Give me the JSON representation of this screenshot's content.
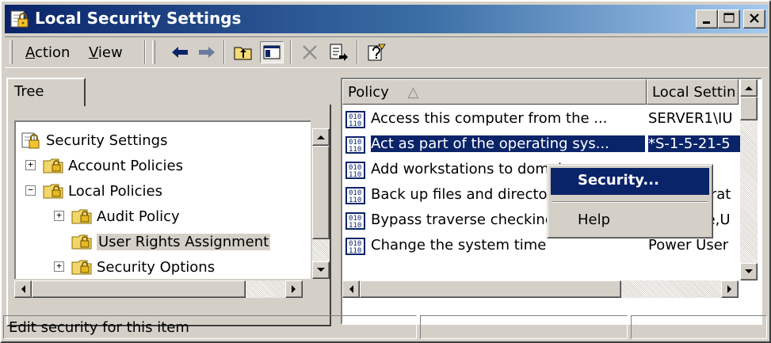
{
  "window": {
    "title": "Local Security Settings",
    "minimize_icon": "minimize-icon",
    "maximize_icon": "maximize-icon",
    "close_icon": "close-icon"
  },
  "toolbar": {
    "action_label": "Action",
    "action_mnemonic": "A",
    "view_label": "View",
    "view_mnemonic": "V",
    "icons": [
      "back-arrow-icon",
      "forward-arrow-icon",
      "up-folder-icon",
      "show-hide-tree-icon",
      "delete-icon",
      "export-list-icon",
      "help-icon"
    ]
  },
  "tree_pane": {
    "tab_label": "Tree",
    "items": [
      {
        "label": "Security Settings",
        "icon": "security-settings-icon",
        "level": 0,
        "expander": ""
      },
      {
        "label": "Account Policies",
        "icon": "folder-lock-icon",
        "level": 1,
        "expander": "+"
      },
      {
        "label": "Local Policies",
        "icon": "folder-lock-icon",
        "level": 1,
        "expander": "-"
      },
      {
        "label": "Audit Policy",
        "icon": "folder-lock-icon",
        "level": 2,
        "expander": "+"
      },
      {
        "label": "User Rights Assignment",
        "icon": "folder-lock-icon",
        "level": 2,
        "expander": "",
        "selected": true
      },
      {
        "label": "Security Options",
        "icon": "folder-lock-icon",
        "level": 2,
        "expander": "+"
      }
    ]
  },
  "list_pane": {
    "columns": [
      {
        "label": "Policy",
        "sort_indicator": "△"
      },
      {
        "label": "Local Settin"
      }
    ],
    "rows": [
      {
        "policy": "Access this computer from the ...",
        "setting": "SERVER1\\IU"
      },
      {
        "policy": "Act as part of the operating sys...",
        "setting": "*S-1-5-21-5",
        "selected": true
      },
      {
        "policy": "Add workstations to domain",
        "setting": ""
      },
      {
        "policy": "Back up files and directories",
        "setting": "Administrat"
      },
      {
        "policy": "Bypass traverse checking",
        "setting": "Everyone,U"
      },
      {
        "policy": "Change the system time",
        "setting": "Power User"
      }
    ]
  },
  "context_menu": {
    "items": [
      "Security...",
      "Help"
    ]
  },
  "status_bar": {
    "text": "Edit security for this item"
  },
  "colors": {
    "title_start": "#0a246a",
    "title_end": "#a6caf0",
    "selection": "#0a246a",
    "face": "#d4d0c8"
  }
}
